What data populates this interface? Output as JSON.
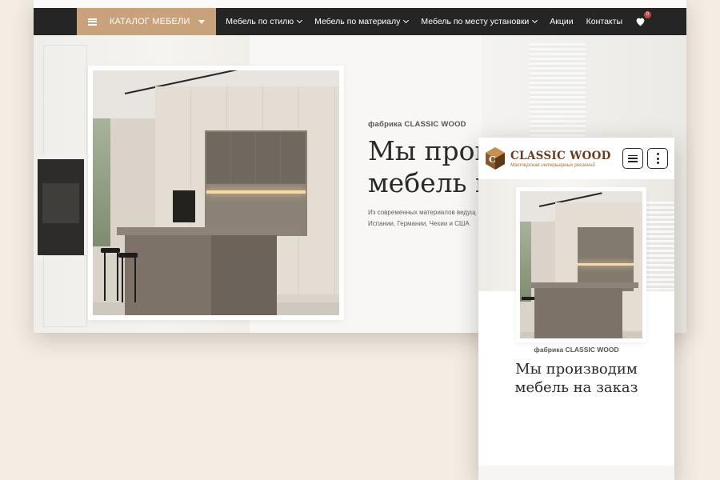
{
  "desktop": {
    "navbar": {
      "catalog_label": "КАТАЛОГ МЕБЕЛИ",
      "menu": [
        {
          "label": "Мебель по стилю",
          "has_dropdown": true
        },
        {
          "label": "Мебель по материалу",
          "has_dropdown": true
        },
        {
          "label": "Мебель по месту установки",
          "has_dropdown": true
        },
        {
          "label": "Акции",
          "has_dropdown": false
        },
        {
          "label": "Контакты",
          "has_dropdown": false
        }
      ],
      "favorites_count": "0"
    },
    "hero": {
      "factory": "фабрика CLASSIC WOOD",
      "headline": "Мы прои\nмебель н",
      "subtext": "Из современных материалов ведущ\nИспании, Германии, Чехии и США"
    }
  },
  "mobile": {
    "logo": {
      "name": "CLASSIC WOOD",
      "tagline": "Мастерская интерьерных решений"
    },
    "hero": {
      "factory": "фабрика CLASSIC WOOD",
      "headline": "Мы производим\nмебель на заказ"
    }
  },
  "colors": {
    "accent": "#c7a27a",
    "navbar": "#252525",
    "background": "#f3ede4",
    "logo_brown": "#6a3d1e",
    "badge": "#c24a3a"
  },
  "icons": [
    "menu-icon",
    "caret-down-icon",
    "chevron-down-icon",
    "heart-icon",
    "logo-mark",
    "hamburger-icon",
    "more-vertical-icon"
  ]
}
